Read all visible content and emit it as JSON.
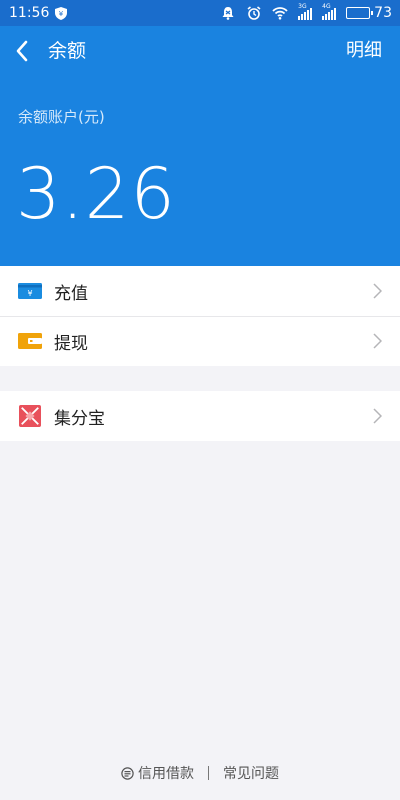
{
  "status_bar": {
    "time": "11:56",
    "network_1": "3G",
    "network_2": "4G",
    "battery": "73",
    "battery_level_percent": 73
  },
  "header": {
    "title": "余额",
    "action": "明细",
    "balance_label": "余额账户(元)",
    "balance_value": "3.26"
  },
  "menu": {
    "recharge": "充值",
    "withdraw": "提现",
    "jifenbao": "集分宝"
  },
  "footer": {
    "credit_loan": "信用借款",
    "faq": "常见问题"
  },
  "colors": {
    "header_blue": "#1a83e0",
    "status_blue": "#1a6dcc",
    "recharge_blue": "#1a8ce0",
    "withdraw_orange": "#f0a30a",
    "jifenbao_red": "#e8505b"
  },
  "icons": {
    "back": "chevron-left-icon",
    "recharge": "recharge-card-icon",
    "withdraw": "wallet-icon",
    "jifenbao": "jifenbao-icon",
    "row_arrow": "chevron-right-icon"
  }
}
